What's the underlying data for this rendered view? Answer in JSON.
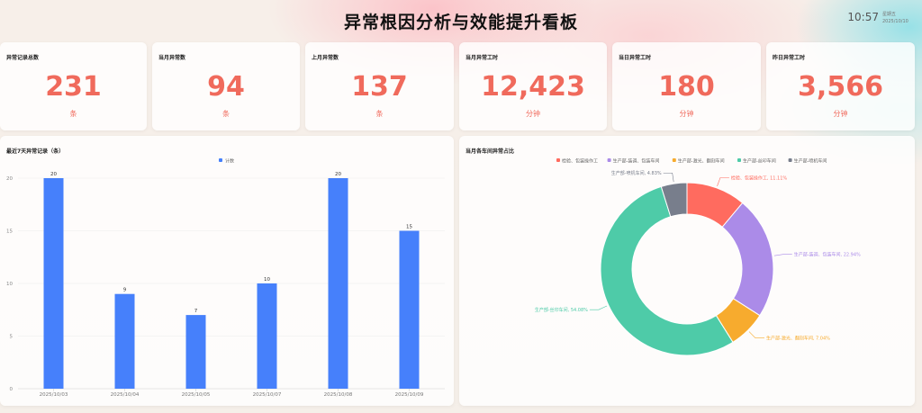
{
  "header": {
    "title": "异常根因分析与效能提升看板",
    "time": "10:57",
    "weekday": "星期五",
    "date": "2025/10/10"
  },
  "kpis": [
    {
      "label": "异常记录总数",
      "value": "231",
      "unit": "条"
    },
    {
      "label": "当月异常数",
      "value": "94",
      "unit": "条"
    },
    {
      "label": "上月异常数",
      "value": "137",
      "unit": "条"
    },
    {
      "label": "当月异常工时",
      "value": "12,423",
      "unit": "分钟"
    },
    {
      "label": "当日异常工时",
      "value": "180",
      "unit": "分钟"
    },
    {
      "label": "昨日异常工时",
      "value": "3,566",
      "unit": "分钟"
    }
  ],
  "bar_panel": {
    "title": "最近7天异常记录（条）"
  },
  "pie_panel": {
    "title": "当月各车间异常占比"
  },
  "colors": {
    "bar": "#4680fb",
    "kpi": "#f06a5c",
    "pie": [
      "#ff6b5f",
      "#ab8be8",
      "#f7ab2e",
      "#4ecba8",
      "#787e8c"
    ]
  },
  "chart_data": [
    {
      "type": "bar",
      "title": "最近7天异常记录（条）",
      "categories": [
        "2025/10/03",
        "2025/10/04",
        "2025/10/05",
        "2025/10/07",
        "2025/10/08",
        "2025/10/09"
      ],
      "series": [
        {
          "name": "计数",
          "values": [
            20,
            9,
            7,
            10,
            20,
            15
          ]
        }
      ],
      "yticks": [
        0,
        5,
        10,
        15,
        20
      ],
      "ylim": [
        0,
        20
      ],
      "legend": "top-center",
      "grid": true,
      "data_labels": true
    },
    {
      "type": "pie",
      "title": "当月各车间异常占比",
      "donut": true,
      "legend": "top-center",
      "slices": [
        {
          "name": "检验、包装操作工",
          "value": 11.11,
          "label": "检验、包装操作工, 11.11%"
        },
        {
          "name": "生产部-装调、包装车间",
          "value": 22.94,
          "label": "生产部-装调、包装车间, 22.94%"
        },
        {
          "name": "生产部-激光、翻刻车间",
          "value": 7.04,
          "label": "生产部-激光、翻刻车间, 7.04%"
        },
        {
          "name": "生产部-丝印车间",
          "value": 54.08,
          "label": "生产部-丝印车间, 54.08%"
        },
        {
          "name": "生产部-喷机车间",
          "value": 4.83,
          "label": "生产部-喷机车间, 4.83%"
        }
      ]
    }
  ]
}
